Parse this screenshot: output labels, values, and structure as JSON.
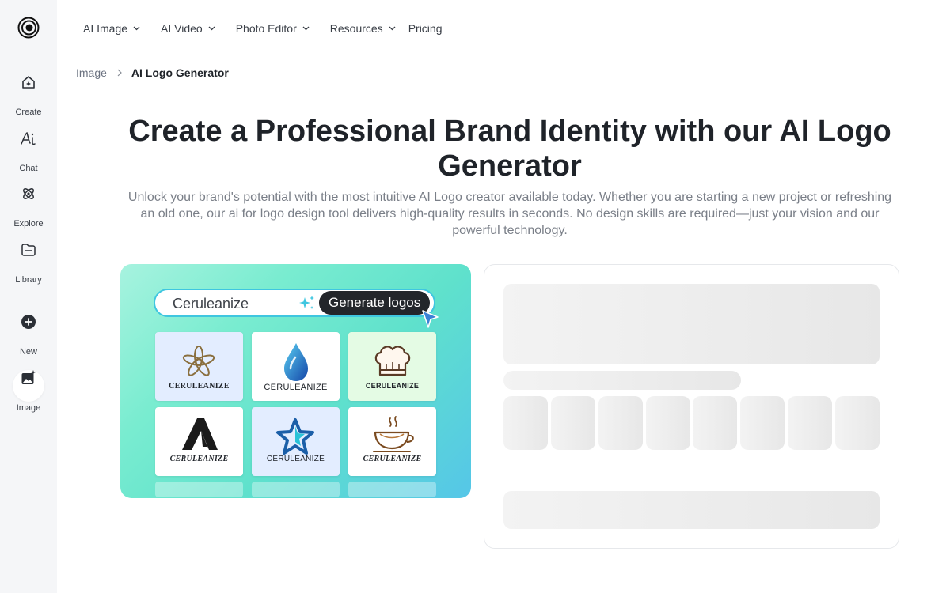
{
  "sidebar": {
    "items": [
      {
        "label": "Create",
        "icon": "home-sparkle-icon"
      },
      {
        "label": "Chat",
        "icon": "ai-chat-icon"
      },
      {
        "label": "Explore",
        "icon": "atom-icon"
      },
      {
        "label": "Library",
        "icon": "folder-icon"
      },
      {
        "label": "New",
        "icon": "plus-circle-icon"
      },
      {
        "label": "Image",
        "icon": "image-sparkle-icon"
      }
    ],
    "active": "Image"
  },
  "nav": {
    "items": [
      {
        "label": "AI Image"
      },
      {
        "label": "AI Video"
      },
      {
        "label": "Photo Editor"
      },
      {
        "label": "Resources"
      },
      {
        "label": "Pricing"
      }
    ]
  },
  "breadcrumb": {
    "parent": "Image",
    "current": "AI Logo Generator"
  },
  "hero": {
    "title": "Create a Professional Brand Identity with our AI Logo Generator",
    "description": "Unlock your brand's potential with the most intuitive AI Logo creator available today. Whether you are starting a new project or refreshing an old one, our ai for logo design tool delivers high-quality results in seconds. No design skills are required—just your vision and our powerful technology."
  },
  "preview": {
    "search_value": "Ceruleanize",
    "button_label": "Generate logos",
    "tiles": [
      {
        "name": "CERULEANIZE",
        "icon": "flower-icon"
      },
      {
        "name": "CERULEANIZE",
        "icon": "water-drop-icon"
      },
      {
        "name": "CERULEANIZE",
        "icon": "chef-hat-icon"
      },
      {
        "name": "CERULEANIZE",
        "icon": "mountain-a-icon"
      },
      {
        "name": "CERULEANIZE",
        "icon": "star-icon"
      },
      {
        "name": "CERULEANIZE",
        "icon": "coffee-cup-icon"
      }
    ]
  },
  "colors": {
    "text_primary": "#1f2329",
    "text_muted": "#7a7f88",
    "sidebar_bg": "#f5f6f8",
    "accent_cyan": "#3fc6e0",
    "button_dark": "#23262b"
  }
}
